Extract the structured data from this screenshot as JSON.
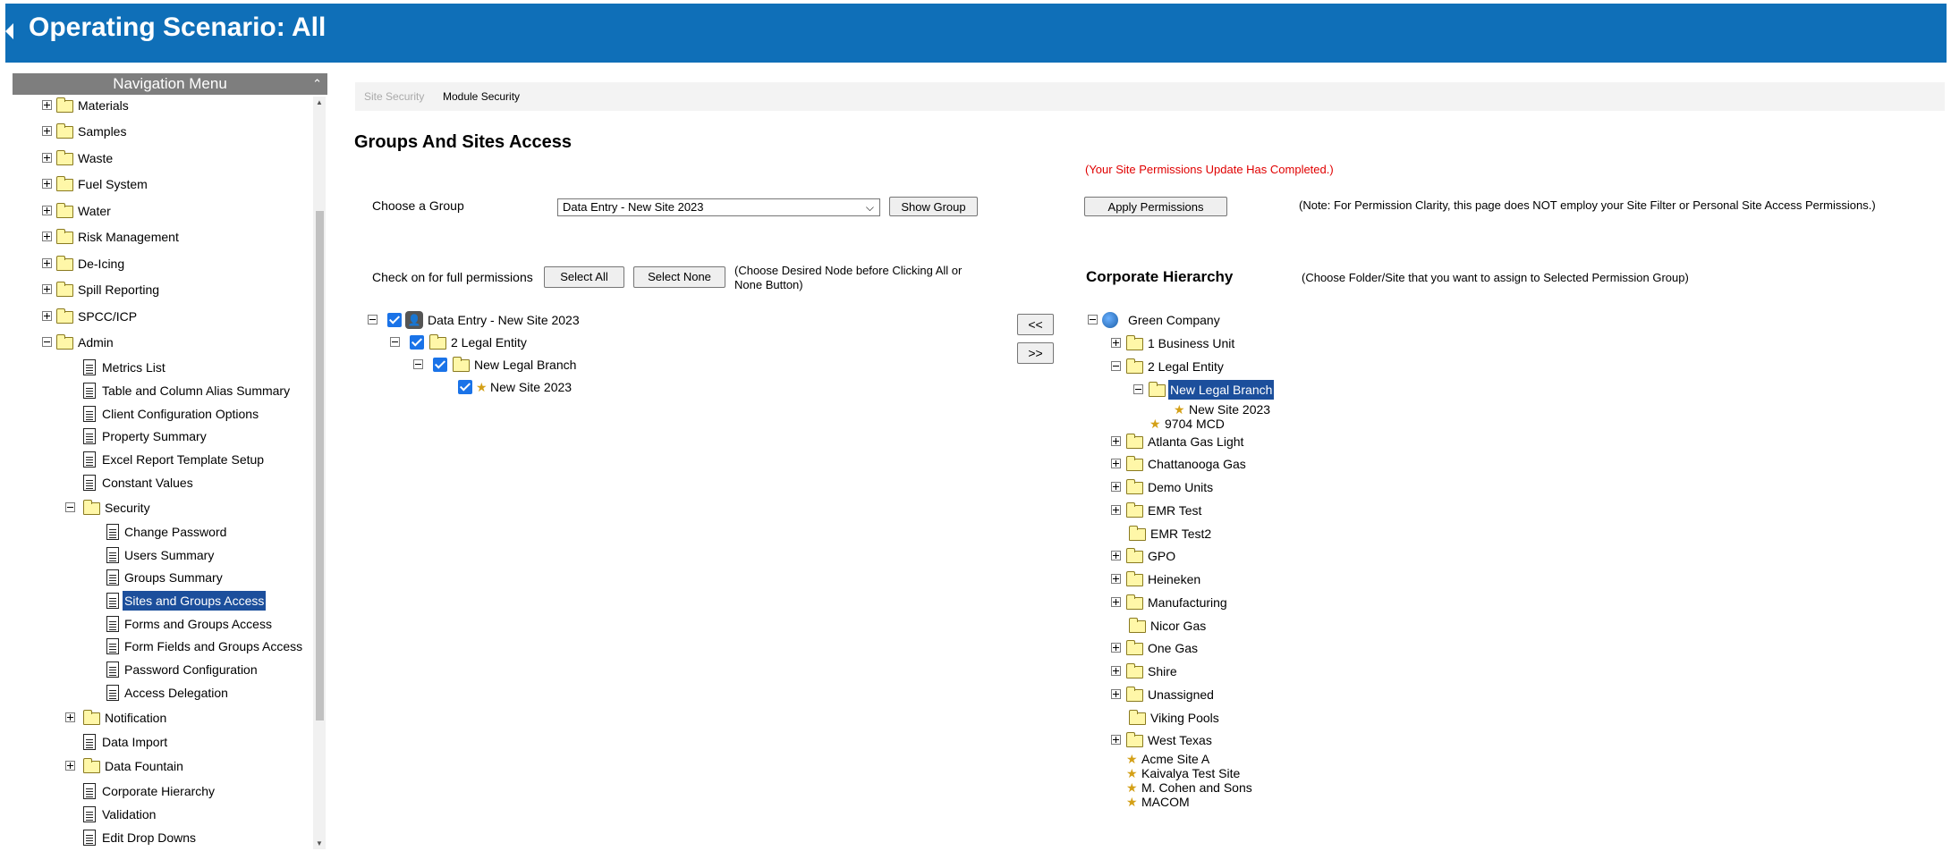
{
  "header": {
    "title": "Operating Scenario: All"
  },
  "nav": {
    "title": "Navigation Menu",
    "items": [
      "Materials",
      "Samples",
      "Waste",
      "Fuel System",
      "Water",
      "Risk Management",
      "De-Icing",
      "Spill Reporting",
      "SPCC/ICP",
      "Admin",
      "Metrics List",
      "Table and Column Alias Summary",
      "Client Configuration Options",
      "Property Summary",
      "Excel Report Template Setup",
      "Constant Values",
      "Security",
      "Change Password",
      "Users Summary",
      "Groups Summary",
      "Sites and Groups Access",
      "Forms and Groups Access",
      "Form Fields and Groups Access",
      "Password Configuration",
      "Access Delegation",
      "Notification",
      "Data Import",
      "Data Fountain",
      "Corporate Hierarchy",
      "Validation",
      "Edit Drop Downs"
    ]
  },
  "tabs": {
    "site_security": "Site Security",
    "module_security": "Module Security"
  },
  "main": {
    "heading": "Groups And Sites Access",
    "status": "(Your Site Permissions Update Has Completed.)",
    "choose_group_label": "Choose a Group",
    "group_selected": "Data Entry - New Site 2023",
    "show_group": "Show Group",
    "apply_permissions": "Apply Permissions",
    "clarity_note": "(Note: For Permission Clarity, this page does NOT employ your Site Filter or Personal Site Access Permissions.)",
    "check_on_label": "Check on for full permissions",
    "select_all": "Select All",
    "select_none": "Select None",
    "choose_node_note_1": "(Choose Desired Node before Clicking All or",
    "choose_node_note_2": "None Button)",
    "move_left": "<<",
    "move_right": ">>",
    "hier_heading": "Corporate Hierarchy",
    "hier_note": "(Choose Folder/Site that you want to assign to Selected Permission Group)"
  },
  "group_tree": [
    "Data Entry - New Site 2023",
    "2 Legal Entity",
    "New Legal Branch",
    "New Site 2023"
  ],
  "corp_tree": [
    "Green Company",
    "1 Business Unit",
    "2 Legal Entity",
    "New Legal Branch",
    "New Site 2023",
    "9704 MCD",
    "Atlanta Gas Light",
    "Chattanooga Gas",
    "Demo Units",
    "EMR Test",
    "EMR Test2",
    "GPO",
    "Heineken",
    "Manufacturing",
    "Nicor Gas",
    "One Gas",
    "Shire",
    "Unassigned",
    "Viking Pools",
    "West Texas",
    "Acme Site A",
    "Kaivalya Test Site",
    "M. Cohen and Sons",
    "MACOM"
  ]
}
